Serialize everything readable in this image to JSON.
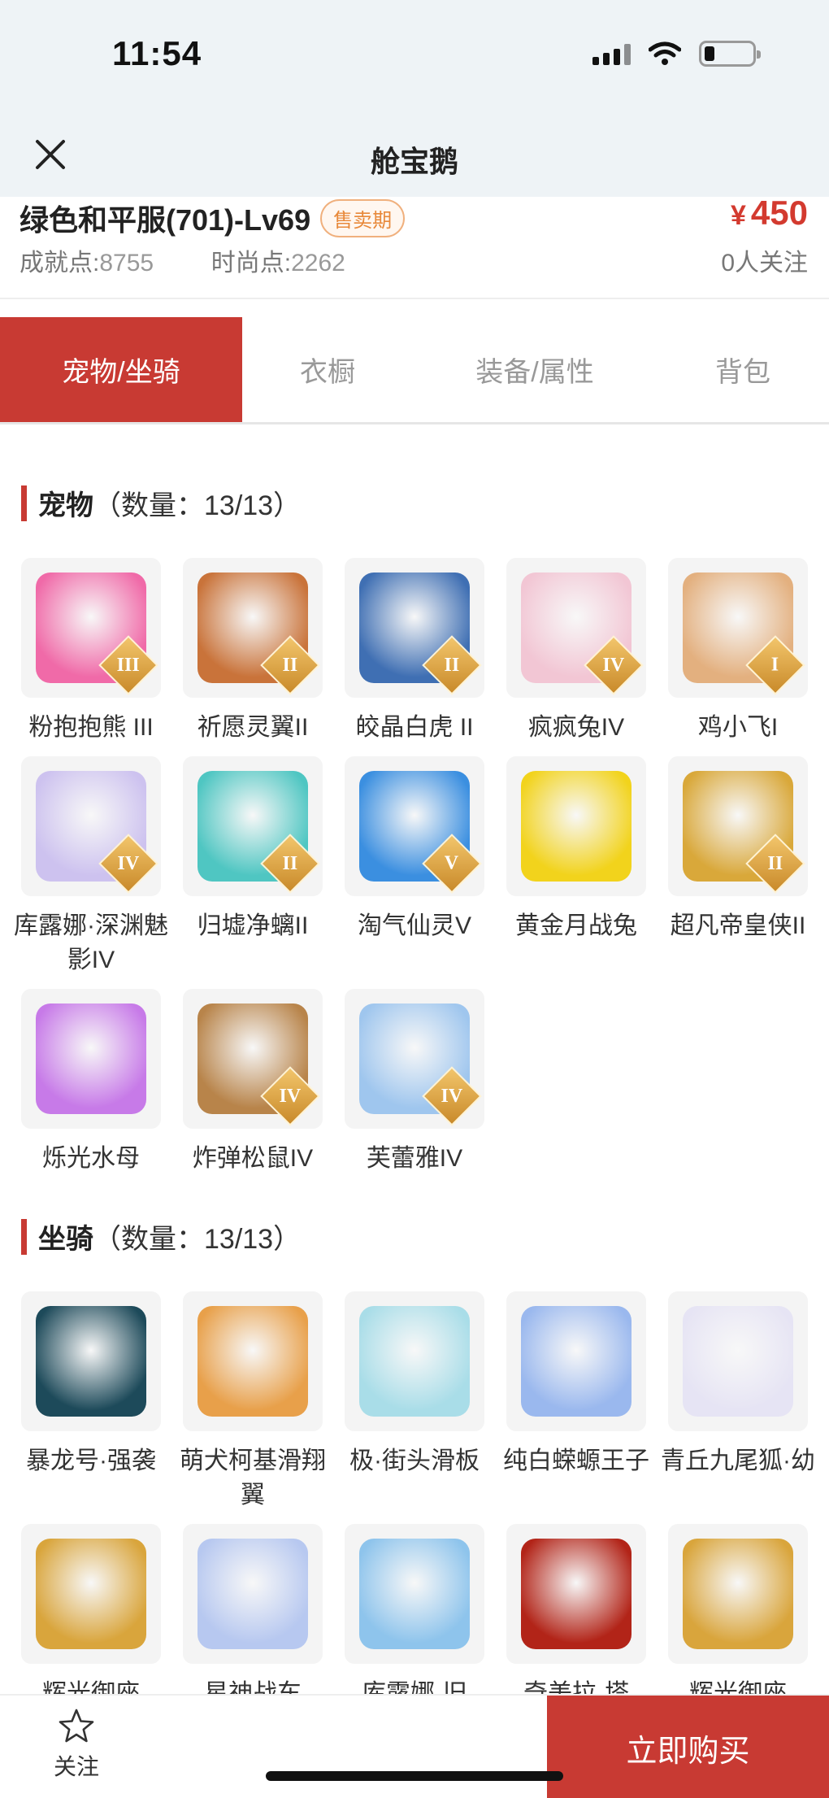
{
  "status": {
    "time": "11:54"
  },
  "nav": {
    "title": "舱宝鹅"
  },
  "item": {
    "name": "绿色和平服(701)-Lv69",
    "badge": "售卖期",
    "achievement_label": "成就点:",
    "achievement_value": "8755",
    "fashion_label": "时尚点:",
    "fashion_value": "2262",
    "currency": "¥",
    "price": "450",
    "followers": "0人关注"
  },
  "tabs": [
    "宠物/坐骑",
    "衣橱",
    "装备/属性",
    "背包"
  ],
  "pets": {
    "title": "宠物",
    "count": "（数量：13/13）",
    "items": [
      {
        "name": "粉抱抱熊 III",
        "level": "III",
        "color": "#f06aa8"
      },
      {
        "name": "祈愿灵翼II",
        "level": "II",
        "color": "#c9733a"
      },
      {
        "name": "皎晶白虎 II",
        "level": "II",
        "color": "#3f6fb3"
      },
      {
        "name": "疯疯兔IV",
        "level": "IV",
        "color": "#f2c6d4"
      },
      {
        "name": "鸡小飞I",
        "level": "I",
        "color": "#e3b07f"
      },
      {
        "name": "库露娜·深渊魅影IV",
        "level": "IV",
        "color": "#cdc2ef"
      },
      {
        "name": "归墟净螭II",
        "level": "II",
        "color": "#4fc6c2"
      },
      {
        "name": "淘气仙灵V",
        "level": "V",
        "color": "#3b8fe0"
      },
      {
        "name": "黄金月战兔",
        "level": "",
        "color": "#f2d31c"
      },
      {
        "name": "超凡帝皇侠II",
        "level": "II",
        "color": "#d9a83a"
      },
      {
        "name": "烁光水母",
        "level": "",
        "color": "#c77ae8"
      },
      {
        "name": "炸弹松鼠IV",
        "level": "IV",
        "color": "#b8844a"
      },
      {
        "name": "芙蕾雅IV",
        "level": "IV",
        "color": "#9fc6ee"
      }
    ]
  },
  "mounts": {
    "title": "坐骑",
    "count": "（数量：13/13）",
    "items": [
      {
        "name": "暴龙号·强袭",
        "color": "#1d4a5a"
      },
      {
        "name": "萌犬柯基滑翔翼",
        "color": "#e8a04a"
      },
      {
        "name": "极·街头滑板",
        "color": "#a9dde8"
      },
      {
        "name": "纯白蝾螈王子",
        "color": "#9ab8ee"
      },
      {
        "name": "青丘九尾狐·幼",
        "color": "#e6e4f4"
      },
      {
        "name": "辉光御座",
        "color": "#d9a53c"
      },
      {
        "name": "星神战车",
        "color": "#b7c8f0"
      },
      {
        "name": "库露娜-旧",
        "color": "#8ec4ec"
      },
      {
        "name": "奇美拉-塔",
        "color": "#b22418"
      },
      {
        "name": "辉光御座",
        "color": "#d9a53c"
      }
    ]
  },
  "bottom": {
    "follow": "关注",
    "buy": "立即购买"
  }
}
